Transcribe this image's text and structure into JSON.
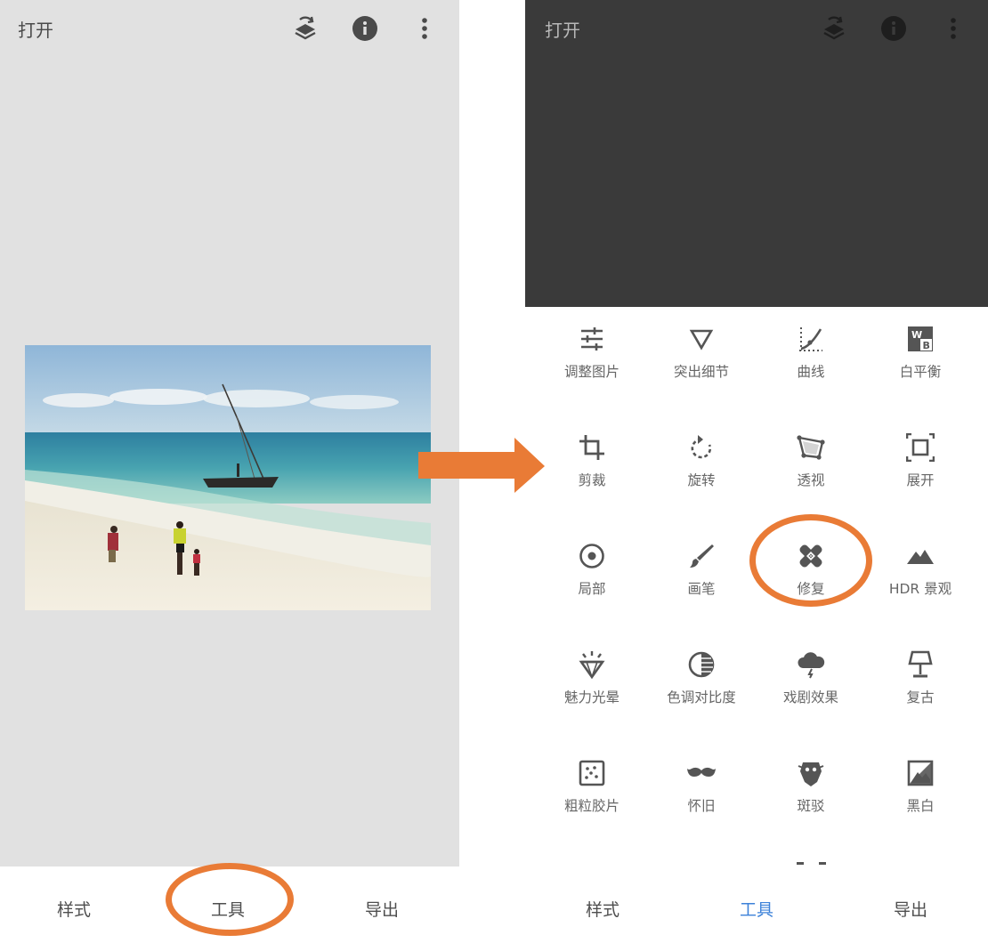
{
  "left_screen": {
    "app_title": "打开",
    "tabs": {
      "styles": "样式",
      "tools": "工具",
      "export": "导出"
    }
  },
  "right_screen": {
    "app_title": "打开",
    "tabs": {
      "styles": "样式",
      "tools": "工具",
      "export": "导出"
    },
    "active_tab": "工具",
    "tools": [
      {
        "label": "调整图片",
        "icon": "tune-sliders-icon"
      },
      {
        "label": "突出细节",
        "icon": "details-triangle-icon"
      },
      {
        "label": "曲线",
        "icon": "curves-icon"
      },
      {
        "label": "白平衡",
        "icon": "white-balance-icon"
      },
      {
        "label": "剪裁",
        "icon": "crop-icon"
      },
      {
        "label": "旋转",
        "icon": "rotate-icon"
      },
      {
        "label": "透视",
        "icon": "perspective-icon"
      },
      {
        "label": "展开",
        "icon": "expand-icon"
      },
      {
        "label": "局部",
        "icon": "selective-icon"
      },
      {
        "label": "画笔",
        "icon": "brush-icon"
      },
      {
        "label": "修复",
        "icon": "healing-bandage-icon"
      },
      {
        "label": "HDR 景观",
        "icon": "hdr-mountain-icon"
      },
      {
        "label": "魅力光晕",
        "icon": "glamour-glow-icon"
      },
      {
        "label": "色调对比度",
        "icon": "tonal-contrast-icon"
      },
      {
        "label": "戏剧效果",
        "icon": "drama-cloud-icon"
      },
      {
        "label": "复古",
        "icon": "vintage-lamp-icon"
      },
      {
        "label": "粗粒胶片",
        "icon": "grainy-film-icon"
      },
      {
        "label": "怀旧",
        "icon": "retrolux-mustache-icon"
      },
      {
        "label": "斑驳",
        "icon": "grunge-icon"
      },
      {
        "label": "黑白",
        "icon": "black-white-icon"
      }
    ]
  },
  "colors": {
    "accent_orange": "#e97b36",
    "active_tab_blue": "#3d82d9",
    "left_bg": "#e1e1e1",
    "dark_preview": "#3a3a3a"
  },
  "annotations": {
    "circled_items": [
      "工具",
      "修复"
    ],
    "arrow_direction": "right"
  }
}
